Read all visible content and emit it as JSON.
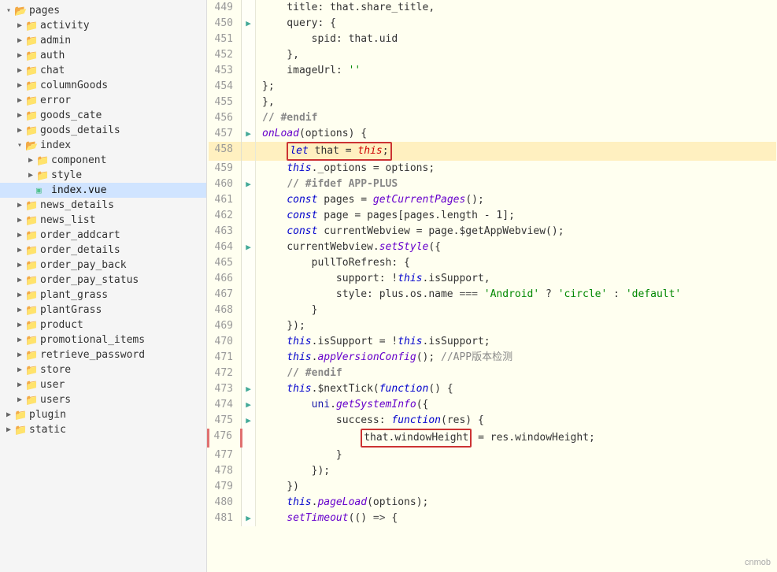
{
  "sidebar": {
    "root": "pages",
    "items": [
      {
        "id": "pages",
        "label": "pages",
        "level": 0,
        "type": "folder",
        "expanded": true,
        "arrow": "▾"
      },
      {
        "id": "activity",
        "label": "activity",
        "level": 1,
        "type": "folder",
        "expanded": false,
        "arrow": "▶"
      },
      {
        "id": "admin",
        "label": "admin",
        "level": 1,
        "type": "folder",
        "expanded": false,
        "arrow": "▶"
      },
      {
        "id": "auth",
        "label": "auth",
        "level": 1,
        "type": "folder",
        "expanded": false,
        "arrow": "▶"
      },
      {
        "id": "chat",
        "label": "chat",
        "level": 1,
        "type": "folder",
        "expanded": false,
        "arrow": "▶"
      },
      {
        "id": "columnGoods",
        "label": "columnGoods",
        "level": 1,
        "type": "folder",
        "expanded": false,
        "arrow": "▶"
      },
      {
        "id": "error",
        "label": "error",
        "level": 1,
        "type": "folder",
        "expanded": false,
        "arrow": "▶"
      },
      {
        "id": "goods_cate",
        "label": "goods_cate",
        "level": 1,
        "type": "folder",
        "expanded": false,
        "arrow": "▶"
      },
      {
        "id": "goods_details",
        "label": "goods_details",
        "level": 1,
        "type": "folder",
        "expanded": false,
        "arrow": "▶"
      },
      {
        "id": "index",
        "label": "index",
        "level": 1,
        "type": "folder",
        "expanded": true,
        "arrow": "▾"
      },
      {
        "id": "component",
        "label": "component",
        "level": 2,
        "type": "folder",
        "expanded": false,
        "arrow": "▶"
      },
      {
        "id": "style",
        "label": "style",
        "level": 2,
        "type": "folder",
        "expanded": false,
        "arrow": "▶"
      },
      {
        "id": "index.vue",
        "label": "index.vue",
        "level": 2,
        "type": "vue",
        "expanded": false,
        "arrow": "",
        "selected": true
      },
      {
        "id": "news_details",
        "label": "news_details",
        "level": 1,
        "type": "folder",
        "expanded": false,
        "arrow": "▶"
      },
      {
        "id": "news_list",
        "label": "news_list",
        "level": 1,
        "type": "folder",
        "expanded": false,
        "arrow": "▶"
      },
      {
        "id": "order_addcart",
        "label": "order_addcart",
        "level": 1,
        "type": "folder",
        "expanded": false,
        "arrow": "▶"
      },
      {
        "id": "order_details",
        "label": "order_details",
        "level": 1,
        "type": "folder",
        "expanded": false,
        "arrow": "▶"
      },
      {
        "id": "order_pay_back",
        "label": "order_pay_back",
        "level": 1,
        "type": "folder",
        "expanded": false,
        "arrow": "▶"
      },
      {
        "id": "order_pay_status",
        "label": "order_pay_status",
        "level": 1,
        "type": "folder",
        "expanded": false,
        "arrow": "▶"
      },
      {
        "id": "plant_grass",
        "label": "plant_grass",
        "level": 1,
        "type": "folder",
        "expanded": false,
        "arrow": "▶"
      },
      {
        "id": "plantGrass",
        "label": "plantGrass",
        "level": 1,
        "type": "folder",
        "expanded": false,
        "arrow": "▶"
      },
      {
        "id": "product",
        "label": "product",
        "level": 1,
        "type": "folder",
        "expanded": false,
        "arrow": "▶"
      },
      {
        "id": "promotional_items",
        "label": "promotional_items",
        "level": 1,
        "type": "folder",
        "expanded": false,
        "arrow": "▶"
      },
      {
        "id": "retrieve_password",
        "label": "retrieve_password",
        "level": 1,
        "type": "folder",
        "expanded": false,
        "arrow": "▶"
      },
      {
        "id": "store",
        "label": "store",
        "level": 1,
        "type": "folder",
        "expanded": false,
        "arrow": "▶"
      },
      {
        "id": "user",
        "label": "user",
        "level": 1,
        "type": "folder",
        "expanded": false,
        "arrow": "▶"
      },
      {
        "id": "users",
        "label": "users",
        "level": 1,
        "type": "folder",
        "expanded": false,
        "arrow": "▶"
      },
      {
        "id": "plugin",
        "label": "plugin",
        "level": 0,
        "type": "folder",
        "expanded": false,
        "arrow": "▶"
      },
      {
        "id": "static",
        "label": "static",
        "level": 0,
        "type": "folder",
        "expanded": false,
        "arrow": "▶"
      }
    ]
  },
  "editor": {
    "lines": [
      {
        "num": 449,
        "gutter": "",
        "content": "    title: that.share_title,",
        "highlight": false,
        "border": false
      },
      {
        "num": 450,
        "gutter": "▶",
        "content": "    query: {",
        "highlight": false,
        "border": false
      },
      {
        "num": 451,
        "gutter": "",
        "content": "        spid: that.uid",
        "highlight": false,
        "border": false
      },
      {
        "num": 452,
        "gutter": "",
        "content": "    },",
        "highlight": false,
        "border": false
      },
      {
        "num": 453,
        "gutter": "",
        "content": "    imageUrl: ''",
        "highlight": false,
        "border": false
      },
      {
        "num": 454,
        "gutter": "",
        "content": "};",
        "highlight": false,
        "border": false
      },
      {
        "num": 455,
        "gutter": "",
        "content": "},",
        "highlight": false,
        "border": false
      },
      {
        "num": 456,
        "gutter": "",
        "content": "// #endif",
        "highlight": false,
        "border": false
      },
      {
        "num": 457,
        "gutter": "▶",
        "content": "onLoad(options) {",
        "highlight": false,
        "border": false
      },
      {
        "num": 458,
        "gutter": "",
        "content": "    let that = this;",
        "highlight": true,
        "border": false,
        "boxed": true
      },
      {
        "num": 459,
        "gutter": "",
        "content": "    this._options = options;",
        "highlight": false,
        "border": false
      },
      {
        "num": 460,
        "gutter": "▶",
        "content": "    // #ifdef APP-PLUS",
        "highlight": false,
        "border": false
      },
      {
        "num": 461,
        "gutter": "",
        "content": "    const pages = getCurrentPages();",
        "highlight": false,
        "border": false
      },
      {
        "num": 462,
        "gutter": "",
        "content": "    const page = pages[pages.length - 1];",
        "highlight": false,
        "border": false
      },
      {
        "num": 463,
        "gutter": "",
        "content": "    const currentWebview = page.$getAppWebview();",
        "highlight": false,
        "border": false
      },
      {
        "num": 464,
        "gutter": "▶",
        "content": "    currentWebview.setStyle({",
        "highlight": false,
        "border": false
      },
      {
        "num": 465,
        "gutter": "",
        "content": "        pullToRefresh: {",
        "highlight": false,
        "border": false
      },
      {
        "num": 466,
        "gutter": "",
        "content": "            support: !this.isSupport,",
        "highlight": false,
        "border": false
      },
      {
        "num": 467,
        "gutter": "",
        "content": "            style: plus.os.name === 'Android' ? 'circle' : 'default'",
        "highlight": false,
        "border": false
      },
      {
        "num": 468,
        "gutter": "",
        "content": "        }",
        "highlight": false,
        "border": false
      },
      {
        "num": 469,
        "gutter": "",
        "content": "    });",
        "highlight": false,
        "border": false
      },
      {
        "num": 470,
        "gutter": "",
        "content": "    this.isSupport = !this.isSupport;",
        "highlight": false,
        "border": false
      },
      {
        "num": 471,
        "gutter": "",
        "content": "    this.appVersionConfig(); //APP版本检测",
        "highlight": false,
        "border": false
      },
      {
        "num": 472,
        "gutter": "",
        "content": "    // #endif",
        "highlight": false,
        "border": false
      },
      {
        "num": 473,
        "gutter": "▶",
        "content": "    this.$nextTick(function() {",
        "highlight": false,
        "border": false
      },
      {
        "num": 474,
        "gutter": "▶",
        "content": "        uni.getSystemInfo({",
        "highlight": false,
        "border": false
      },
      {
        "num": 475,
        "gutter": "▶",
        "content": "            success: function(res) {",
        "highlight": false,
        "border": false
      },
      {
        "num": 476,
        "gutter": "",
        "content": "                that.windowHeight = res.windowHeight;",
        "highlight": false,
        "border": true,
        "boxed2": true
      },
      {
        "num": 477,
        "gutter": "",
        "content": "            }",
        "highlight": false,
        "border": false
      },
      {
        "num": 478,
        "gutter": "",
        "content": "        });",
        "highlight": false,
        "border": false
      },
      {
        "num": 479,
        "gutter": "",
        "content": "    })",
        "highlight": false,
        "border": false
      },
      {
        "num": 480,
        "gutter": "",
        "content": "    this.pageLoad(options);",
        "highlight": false,
        "border": false
      },
      {
        "num": 481,
        "gutter": "▶",
        "content": "    setTimeout(() => {",
        "highlight": false,
        "border": false
      }
    ]
  },
  "watermark": "cnmob"
}
